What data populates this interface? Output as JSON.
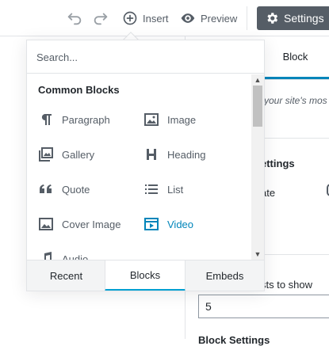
{
  "toolbar": {
    "insert_label": "Insert",
    "preview_label": "Preview",
    "settings_label": "Settings"
  },
  "sidebar": {
    "tab_label": "Block",
    "description": "your site's mos",
    "settings_title": "ettings",
    "date_label": "ate",
    "posts_label": "sts to show",
    "posts_value": "5",
    "partial_heading": "Block Settings"
  },
  "inserter": {
    "search_placeholder": "Search...",
    "section_title": "Common Blocks",
    "blocks": [
      {
        "label": "Paragraph",
        "icon": "paragraph-icon"
      },
      {
        "label": "Image",
        "icon": "image-icon"
      },
      {
        "label": "Gallery",
        "icon": "gallery-icon"
      },
      {
        "label": "Heading",
        "icon": "heading-icon"
      },
      {
        "label": "Quote",
        "icon": "quote-icon"
      },
      {
        "label": "List",
        "icon": "list-icon"
      },
      {
        "label": "Cover Image",
        "icon": "cover-image-icon"
      },
      {
        "label": "Video",
        "icon": "video-icon"
      },
      {
        "label": "Audio",
        "icon": "audio-icon"
      }
    ],
    "tabs": [
      "Recent",
      "Blocks",
      "Embeds"
    ],
    "active_tab": "Blocks"
  },
  "colors": {
    "accent": "#0085ba",
    "settings_bg": "#555d66"
  }
}
